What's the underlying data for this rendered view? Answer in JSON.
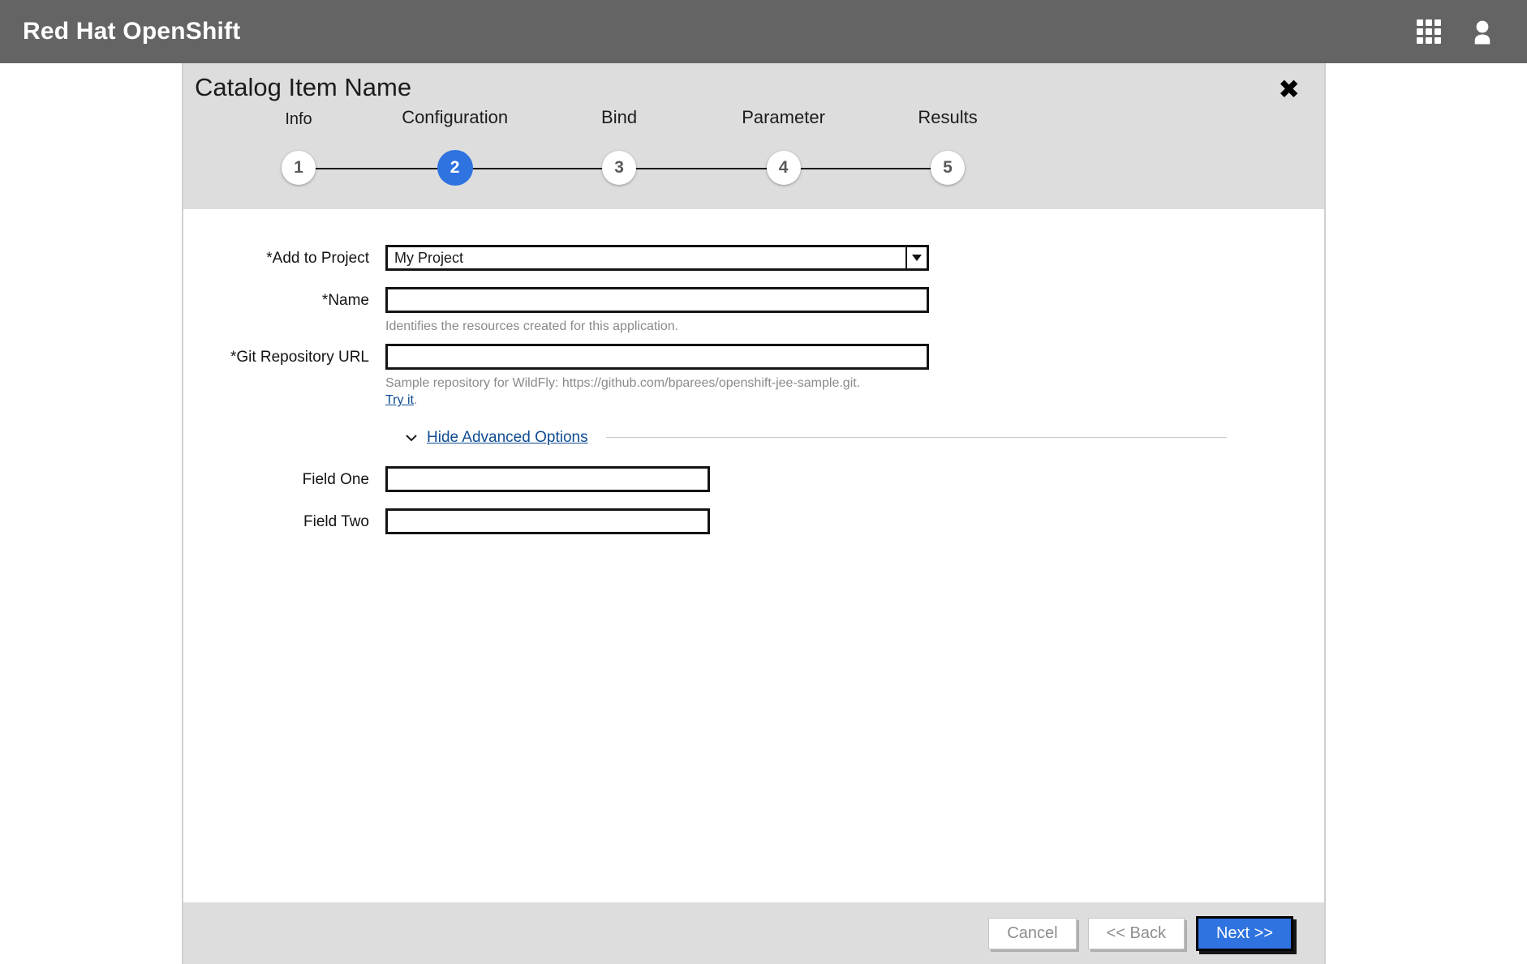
{
  "masthead": {
    "brand": "Red Hat OpenShift",
    "apps_icon": "grid-icon",
    "user_icon": "user-icon",
    "background_color": "#646464"
  },
  "dialog": {
    "title": "Catalog Item Name",
    "close_label": "✖",
    "header_background": "#dddddd"
  },
  "wizard": {
    "active_step": 2,
    "active_color": "#2f73e0",
    "steps": [
      {
        "number": "1",
        "label": "Info"
      },
      {
        "number": "2",
        "label": "Configuration"
      },
      {
        "number": "3",
        "label": "Bind"
      },
      {
        "number": "4",
        "label": "Parameter"
      },
      {
        "number": "5",
        "label": "Results"
      }
    ]
  },
  "form": {
    "project": {
      "label": "*Add to Project",
      "value": "My Project",
      "options": [
        "My Project"
      ]
    },
    "name": {
      "label": "*Name",
      "value": "",
      "placeholder": "",
      "help": "Identifies the resources created for this application."
    },
    "git_url": {
      "label": "*Git Repository URL",
      "value": "",
      "placeholder": "",
      "help": "Sample repository for WildFly: https://github.com/bparees/openshift-jee-sample.git.",
      "try_it_label": "Try it",
      "try_it_suffix": "."
    },
    "advanced": {
      "toggle_label": "Hide Advanced Options",
      "chevron_icon": "chevron-down-icon",
      "fields": [
        {
          "label": "Field One",
          "value": "",
          "placeholder": ""
        },
        {
          "label": "Field Two",
          "value": "",
          "placeholder": ""
        }
      ]
    }
  },
  "footer": {
    "cancel_label": "Cancel",
    "back_label": "<< Back",
    "next_label": "Next >>"
  }
}
